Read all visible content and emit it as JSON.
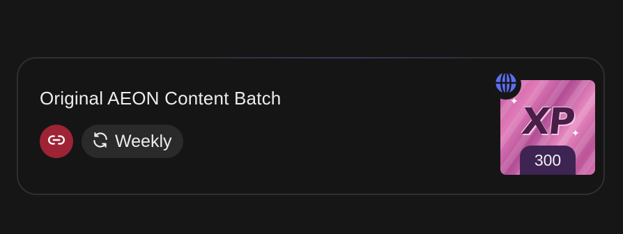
{
  "card": {
    "title": "Original AEON Content Batch",
    "frequency_label": "Weekly"
  },
  "reward": {
    "badge_text": "XP",
    "amount": "300"
  },
  "icons": {
    "link": "link-icon",
    "refresh": "refresh-icon",
    "globe": "globe-icon"
  },
  "colors": {
    "page_bg": "#161617",
    "card_border": "#2f2f31",
    "link_button_bg": "#9e2335",
    "pill_bg": "#2a2a2b",
    "globe": "#5b6ef0",
    "reward_pink": "#e07ab8",
    "reward_amount_bg": "#3e2452"
  }
}
